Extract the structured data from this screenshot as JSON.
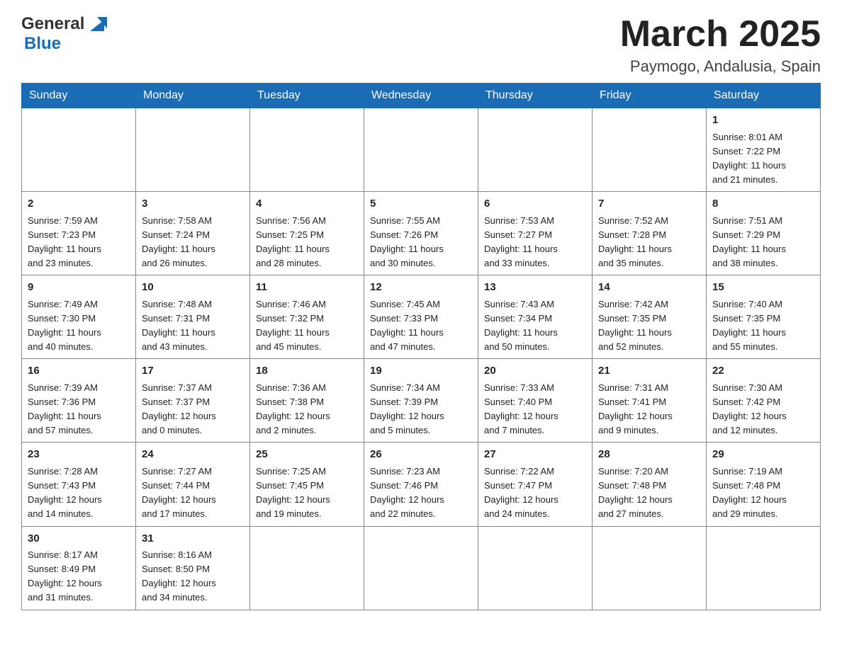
{
  "header": {
    "logo_general": "General",
    "logo_blue": "Blue",
    "title": "March 2025",
    "location": "Paymogo, Andalusia, Spain"
  },
  "weekdays": [
    "Sunday",
    "Monday",
    "Tuesday",
    "Wednesday",
    "Thursday",
    "Friday",
    "Saturday"
  ],
  "weeks": [
    [
      {
        "day": "",
        "info": ""
      },
      {
        "day": "",
        "info": ""
      },
      {
        "day": "",
        "info": ""
      },
      {
        "day": "",
        "info": ""
      },
      {
        "day": "",
        "info": ""
      },
      {
        "day": "",
        "info": ""
      },
      {
        "day": "1",
        "info": "Sunrise: 8:01 AM\nSunset: 7:22 PM\nDaylight: 11 hours\nand 21 minutes."
      }
    ],
    [
      {
        "day": "2",
        "info": "Sunrise: 7:59 AM\nSunset: 7:23 PM\nDaylight: 11 hours\nand 23 minutes."
      },
      {
        "day": "3",
        "info": "Sunrise: 7:58 AM\nSunset: 7:24 PM\nDaylight: 11 hours\nand 26 minutes."
      },
      {
        "day": "4",
        "info": "Sunrise: 7:56 AM\nSunset: 7:25 PM\nDaylight: 11 hours\nand 28 minutes."
      },
      {
        "day": "5",
        "info": "Sunrise: 7:55 AM\nSunset: 7:26 PM\nDaylight: 11 hours\nand 30 minutes."
      },
      {
        "day": "6",
        "info": "Sunrise: 7:53 AM\nSunset: 7:27 PM\nDaylight: 11 hours\nand 33 minutes."
      },
      {
        "day": "7",
        "info": "Sunrise: 7:52 AM\nSunset: 7:28 PM\nDaylight: 11 hours\nand 35 minutes."
      },
      {
        "day": "8",
        "info": "Sunrise: 7:51 AM\nSunset: 7:29 PM\nDaylight: 11 hours\nand 38 minutes."
      }
    ],
    [
      {
        "day": "9",
        "info": "Sunrise: 7:49 AM\nSunset: 7:30 PM\nDaylight: 11 hours\nand 40 minutes."
      },
      {
        "day": "10",
        "info": "Sunrise: 7:48 AM\nSunset: 7:31 PM\nDaylight: 11 hours\nand 43 minutes."
      },
      {
        "day": "11",
        "info": "Sunrise: 7:46 AM\nSunset: 7:32 PM\nDaylight: 11 hours\nand 45 minutes."
      },
      {
        "day": "12",
        "info": "Sunrise: 7:45 AM\nSunset: 7:33 PM\nDaylight: 11 hours\nand 47 minutes."
      },
      {
        "day": "13",
        "info": "Sunrise: 7:43 AM\nSunset: 7:34 PM\nDaylight: 11 hours\nand 50 minutes."
      },
      {
        "day": "14",
        "info": "Sunrise: 7:42 AM\nSunset: 7:35 PM\nDaylight: 11 hours\nand 52 minutes."
      },
      {
        "day": "15",
        "info": "Sunrise: 7:40 AM\nSunset: 7:35 PM\nDaylight: 11 hours\nand 55 minutes."
      }
    ],
    [
      {
        "day": "16",
        "info": "Sunrise: 7:39 AM\nSunset: 7:36 PM\nDaylight: 11 hours\nand 57 minutes."
      },
      {
        "day": "17",
        "info": "Sunrise: 7:37 AM\nSunset: 7:37 PM\nDaylight: 12 hours\nand 0 minutes."
      },
      {
        "day": "18",
        "info": "Sunrise: 7:36 AM\nSunset: 7:38 PM\nDaylight: 12 hours\nand 2 minutes."
      },
      {
        "day": "19",
        "info": "Sunrise: 7:34 AM\nSunset: 7:39 PM\nDaylight: 12 hours\nand 5 minutes."
      },
      {
        "day": "20",
        "info": "Sunrise: 7:33 AM\nSunset: 7:40 PM\nDaylight: 12 hours\nand 7 minutes."
      },
      {
        "day": "21",
        "info": "Sunrise: 7:31 AM\nSunset: 7:41 PM\nDaylight: 12 hours\nand 9 minutes."
      },
      {
        "day": "22",
        "info": "Sunrise: 7:30 AM\nSunset: 7:42 PM\nDaylight: 12 hours\nand 12 minutes."
      }
    ],
    [
      {
        "day": "23",
        "info": "Sunrise: 7:28 AM\nSunset: 7:43 PM\nDaylight: 12 hours\nand 14 minutes."
      },
      {
        "day": "24",
        "info": "Sunrise: 7:27 AM\nSunset: 7:44 PM\nDaylight: 12 hours\nand 17 minutes."
      },
      {
        "day": "25",
        "info": "Sunrise: 7:25 AM\nSunset: 7:45 PM\nDaylight: 12 hours\nand 19 minutes."
      },
      {
        "day": "26",
        "info": "Sunrise: 7:23 AM\nSunset: 7:46 PM\nDaylight: 12 hours\nand 22 minutes."
      },
      {
        "day": "27",
        "info": "Sunrise: 7:22 AM\nSunset: 7:47 PM\nDaylight: 12 hours\nand 24 minutes."
      },
      {
        "day": "28",
        "info": "Sunrise: 7:20 AM\nSunset: 7:48 PM\nDaylight: 12 hours\nand 27 minutes."
      },
      {
        "day": "29",
        "info": "Sunrise: 7:19 AM\nSunset: 7:48 PM\nDaylight: 12 hours\nand 29 minutes."
      }
    ],
    [
      {
        "day": "30",
        "info": "Sunrise: 8:17 AM\nSunset: 8:49 PM\nDaylight: 12 hours\nand 31 minutes."
      },
      {
        "day": "31",
        "info": "Sunrise: 8:16 AM\nSunset: 8:50 PM\nDaylight: 12 hours\nand 34 minutes."
      },
      {
        "day": "",
        "info": ""
      },
      {
        "day": "",
        "info": ""
      },
      {
        "day": "",
        "info": ""
      },
      {
        "day": "",
        "info": ""
      },
      {
        "day": "",
        "info": ""
      }
    ]
  ]
}
